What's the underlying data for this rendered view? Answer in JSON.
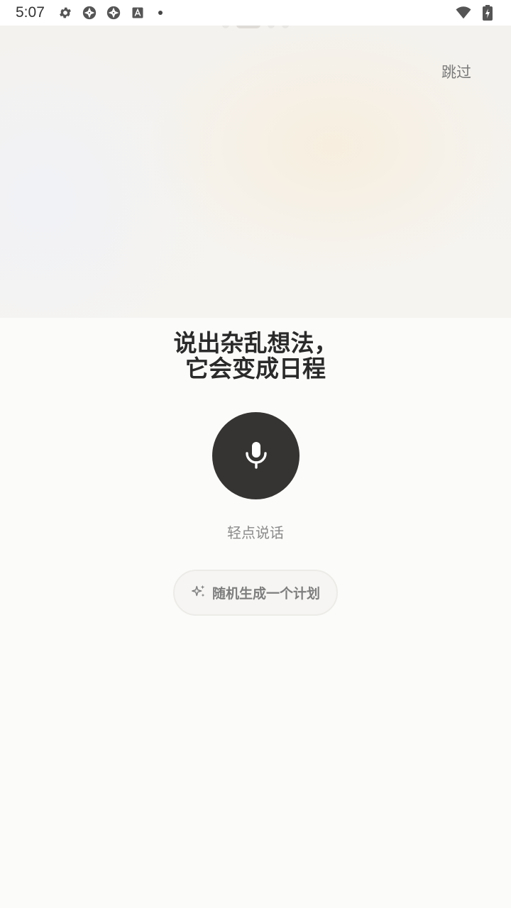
{
  "status_bar": {
    "time": "5:07",
    "icons": [
      "settings-gear-icon",
      "aperture-icon",
      "aperture-icon",
      "font-a-icon",
      "dot-icon"
    ],
    "right_icons": [
      "wifi-icon",
      "battery-charging-icon"
    ]
  },
  "onboarding": {
    "skip_label": "跳过",
    "headline_line1": "说出杂乱想法，",
    "headline_line2": "它会变成日程",
    "mic_hint": "轻点说话",
    "random_plan_label": "随机生成一个计划"
  },
  "colors": {
    "mic_background": "#363432",
    "page_background": "#fbfbf9"
  }
}
